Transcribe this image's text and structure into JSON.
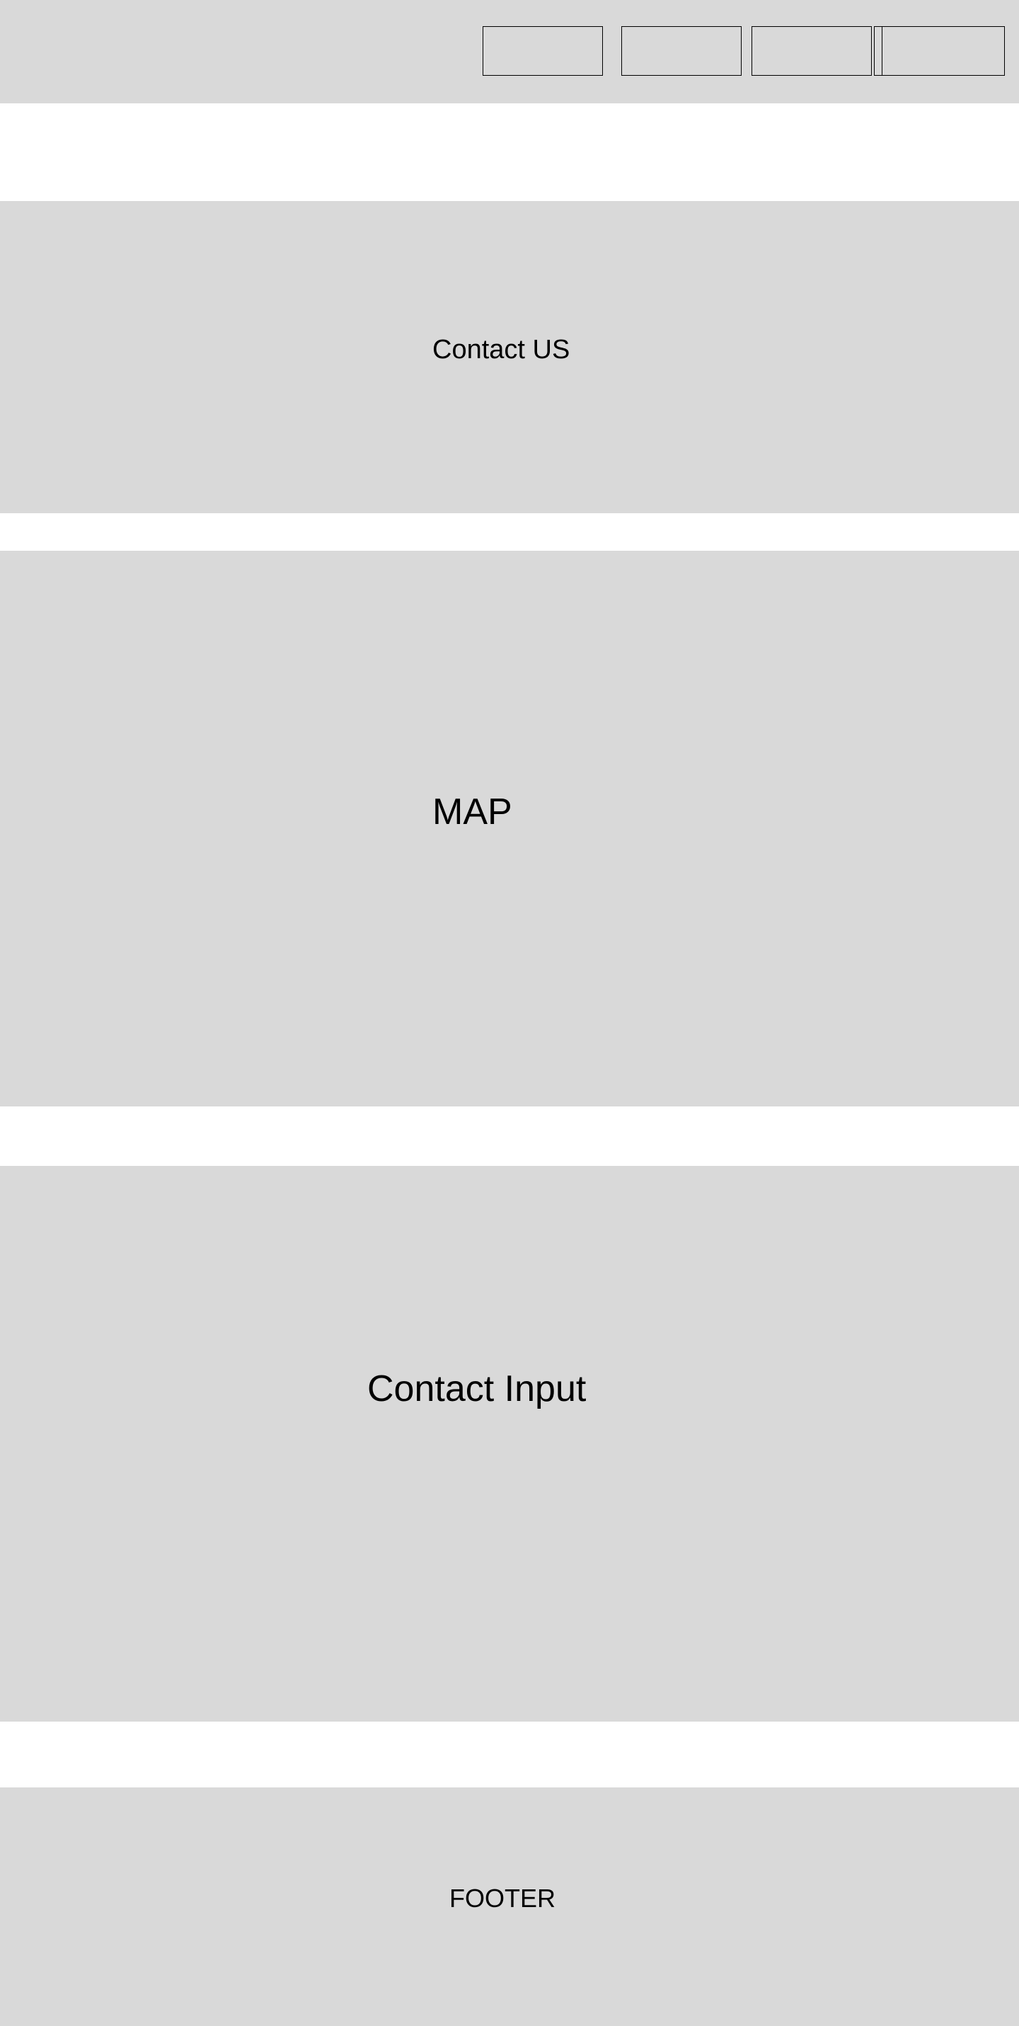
{
  "header": {
    "nav": [
      "",
      "",
      "",
      ""
    ]
  },
  "hero": {
    "title": "Contact US"
  },
  "map": {
    "label": "MAP"
  },
  "contact_input": {
    "label": "Contact Input"
  },
  "footer": {
    "label": "FOOTER"
  },
  "colors": {
    "placeholder_fill": "#d9d9d9",
    "page_background": "#ffffff",
    "text": "#000000",
    "border": "#000000"
  }
}
